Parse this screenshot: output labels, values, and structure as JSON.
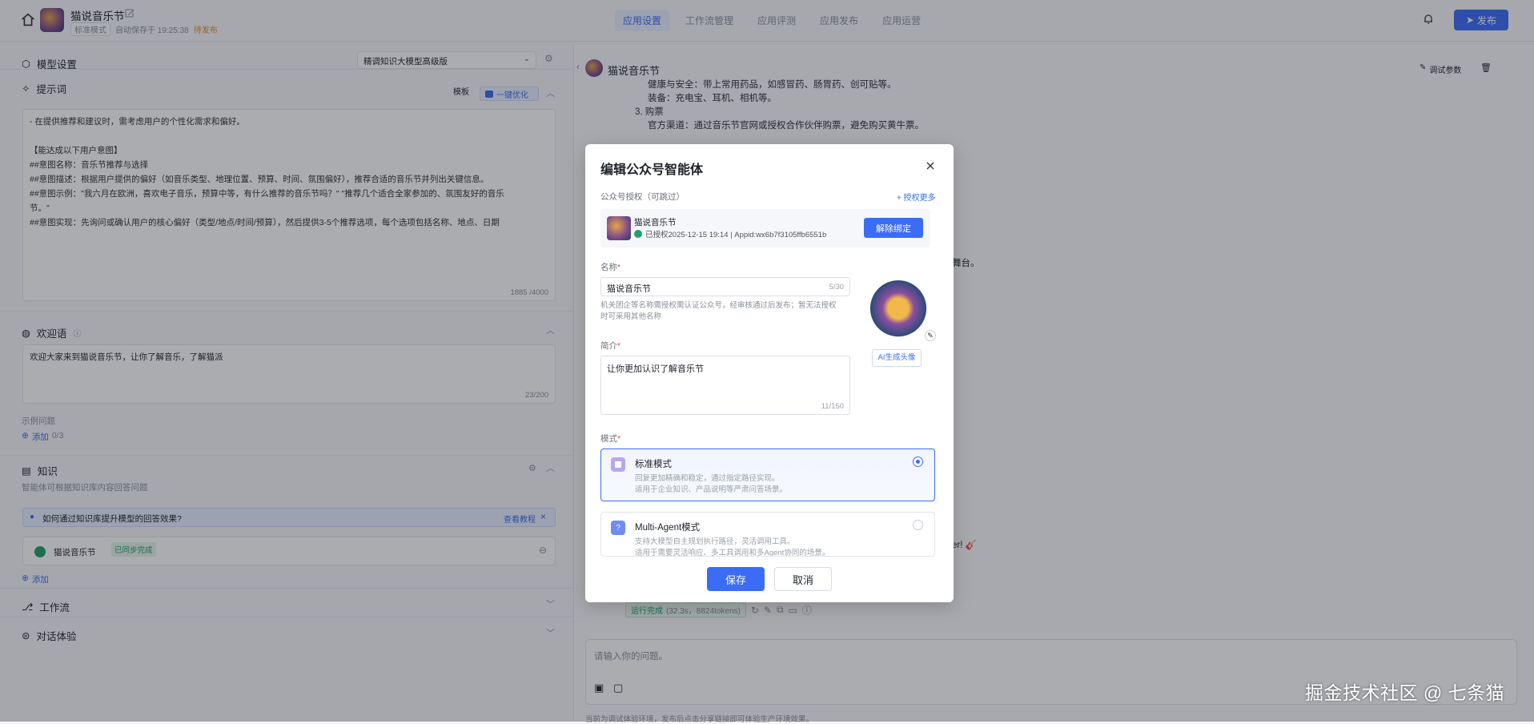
{
  "app": {
    "name": "猫说音乐节",
    "mode_badge": "标准模式",
    "autosave": "自动保存于 19:25:38",
    "status": "待发布"
  },
  "nav": {
    "tabs": [
      "应用设置",
      "工作流管理",
      "应用评测",
      "应用发布",
      "应用运营"
    ],
    "active": 0
  },
  "header": {
    "publish_label": "发布"
  },
  "left": {
    "model": {
      "title": "模型设置",
      "select_value": "精调知识大模型高级版"
    },
    "prompt": {
      "title": "提示词",
      "template_label": "模板",
      "optimize_label": "一键优化",
      "lines": [
        "- 在提供推荐和建议时，需考虑用户的个性化需求和偏好。",
        "",
        "【能达成以下用户意图】",
        "##意图名称：音乐节推荐与选择",
        "##意图描述：根据用户提供的偏好（如音乐类型、地理位置、预算、时间、氛围偏好），推荐合适的音乐节并列出关键信息。",
        "##意图示例：\"我六月在欧洲，喜欢电子音乐，预算中等，有什么推荐的音乐节吗？\" \"推荐几个适合全家参加的、氛围友好的音乐",
        "节。\"",
        "##意图实现：先询问或确认用户的核心偏好（类型/地点/时间/预算），然后提供3-5个推荐选项，每个选项包括名称、地点、日期"
      ],
      "counter": "1885 /4000"
    },
    "welcome": {
      "title": "欢迎语",
      "text": "欢迎大家来到猫说音乐节，让你了解音乐，了解猫派",
      "counter": "23/200",
      "examples_label": "示例问题",
      "add_label": "添加",
      "add_count": "0/3"
    },
    "knowledge": {
      "title": "知识",
      "desc": "智能体可根据知识库内容回答问题",
      "hint": "如何通过知识库提升模型的回答效果?",
      "hint_link": "查看教程",
      "item_name": "猫说音乐节",
      "item_status": "已同步完成",
      "add_label": "添加"
    },
    "workflow": {
      "title": "工作流"
    },
    "chat_exp": {
      "title": "对话体验"
    }
  },
  "right": {
    "bot_name": "猫说音乐节",
    "debug_label": "调试参数",
    "chat_lines": [
      "健康与安全：带上常用药品，如感冒药、肠胃药、创可贴等。",
      "装备：充电宝、耳机、相机等。",
      "3. 购票",
      "官方渠道：通过音乐节官网或授权合作伙伴购票，避免购买黄牛票。"
    ],
    "fragment_stage": "舞台。",
    "fragment_end": "er! 🎸",
    "run_status": "运行完成",
    "run_detail": "(32.3s，8824tokens)",
    "input_placeholder": "请输入你的问题。",
    "footer_note": "当前为调试体验环境，发布后点击分享链接即可体验生产环境效果。"
  },
  "modal": {
    "title": "编辑公众号智能体",
    "auth_label": "公众号授权（可跳过）",
    "auth_more": "+ 授权更多",
    "account_name": "猫说音乐节",
    "account_info": "已授权2025-12-15 19:14 | Appid:wx6b7f3105ffb6551b",
    "unbind_label": "解除绑定",
    "name_label": "名称",
    "name_value": "猫说音乐节",
    "name_count": "5/30",
    "name_hint_1": "机关团企等名称需授权需认证公众号，经审核通过后发布；暂无法授权",
    "name_hint_2": "时可采用其他名称",
    "intro_label": "简介",
    "intro_value": "让你更加认识了解音乐节",
    "intro_count": "11/150",
    "ai_avatar_label": "AI生成头像",
    "mode_label": "模式",
    "modes": [
      {
        "name": "标准模式",
        "desc1": "回复更加精确和稳定，通过指定路径实现。",
        "desc2": "适用于企业知识、产品说明等严肃问答场景。",
        "selected": true
      },
      {
        "name": "Multi-Agent模式",
        "desc1": "支持大模型自主规划执行路径，灵活调用工具。",
        "desc2": "适用于需要灵活响应、多工具调用和多Agent协同的场景。",
        "selected": false
      }
    ],
    "save_label": "保存",
    "cancel_label": "取消"
  },
  "watermark": "掘金技术社区 @ 七条猫",
  "colors": {
    "accent": "#3b6cf6",
    "pending": "#f08a24",
    "success": "#22a06b"
  }
}
